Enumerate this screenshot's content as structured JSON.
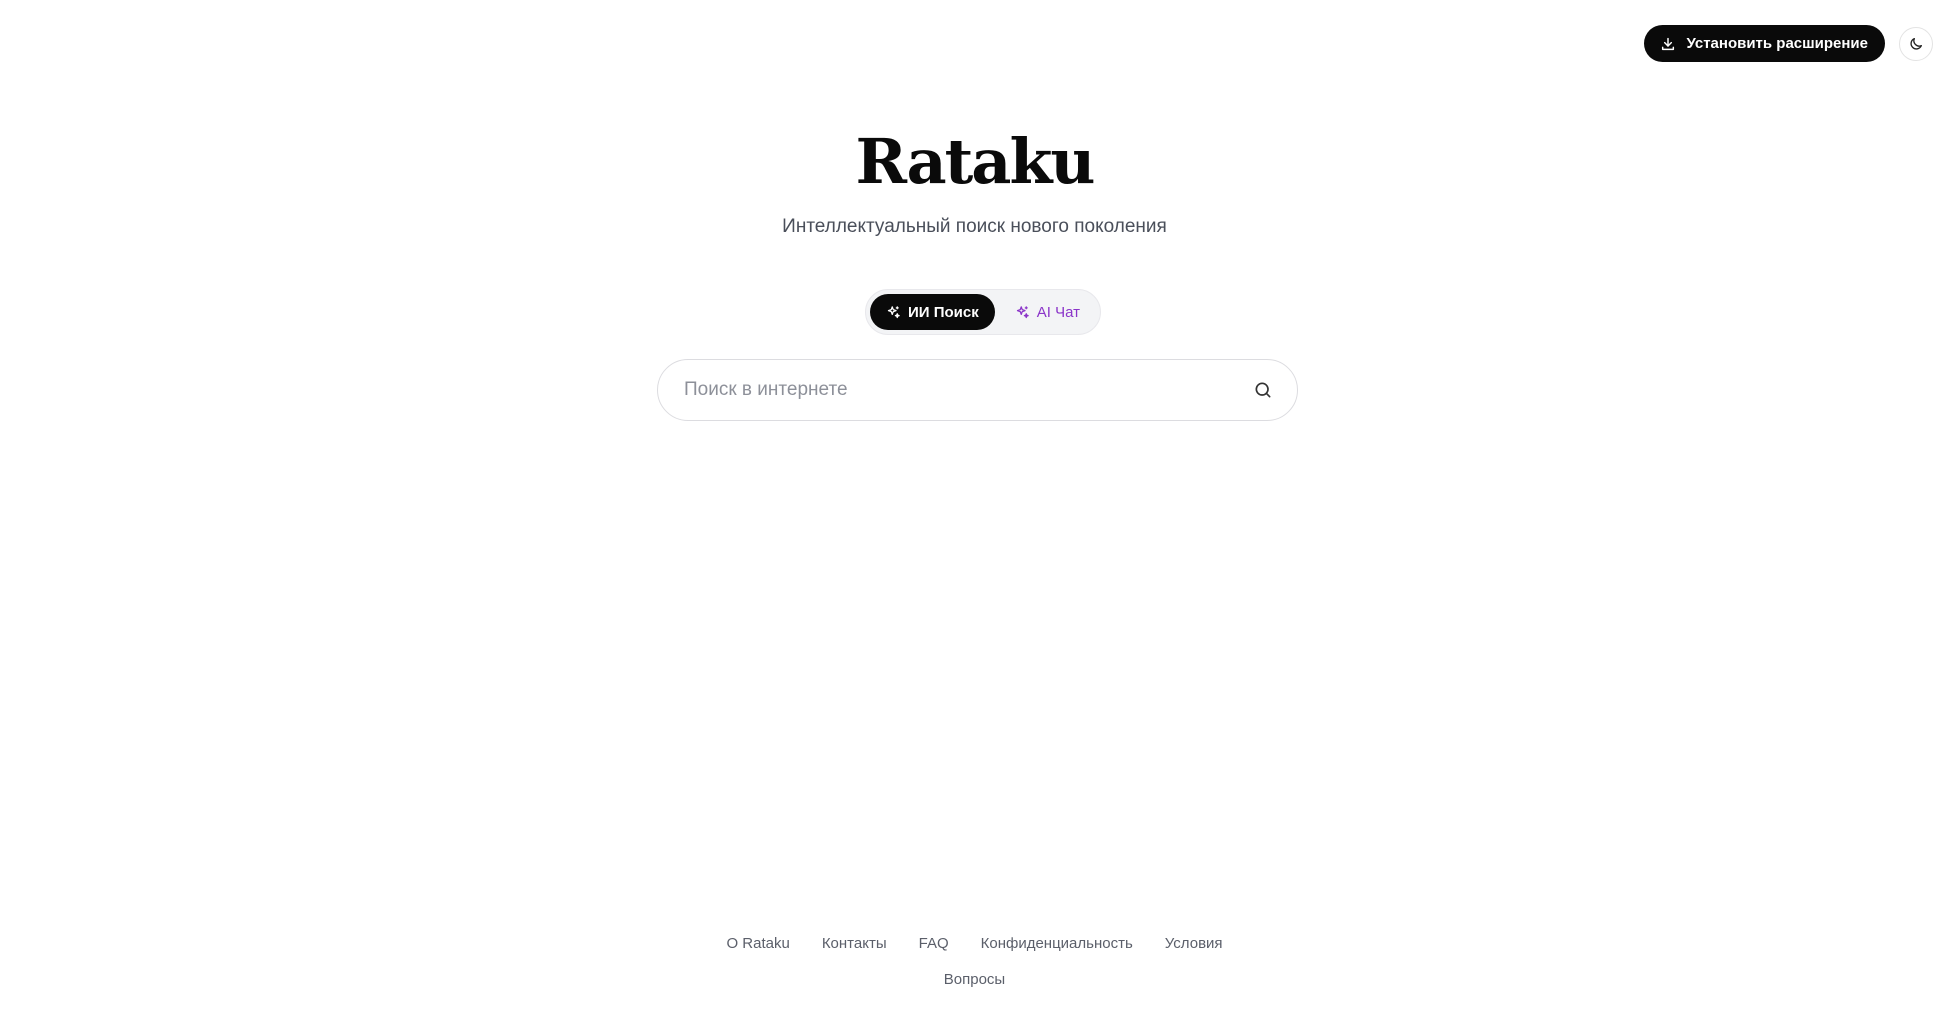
{
  "header": {
    "install_label": "Установить расширение",
    "install_icon": "download-icon",
    "theme_icon": "moon-icon"
  },
  "hero": {
    "logo": "Rataku",
    "tagline": "Интеллектуальный поиск нового поколения"
  },
  "modes": [
    {
      "label": "ИИ Поиск",
      "icon": "sparkles-icon",
      "active": true
    },
    {
      "label": "AI Чат",
      "icon": "sparkles-icon",
      "active": false
    }
  ],
  "search": {
    "placeholder": "Поиск в интернете",
    "value": "",
    "icon": "search-icon"
  },
  "footer": {
    "row1": [
      "О Rataku",
      "Контакты",
      "FAQ",
      "Конфиденциальность",
      "Условия"
    ],
    "row2": [
      "Вопросы"
    ]
  },
  "colors": {
    "primary": "#0a0a0a",
    "accent_purple": "#8b35c9",
    "muted_text": "#5b5f6a",
    "border": "#dcdce0"
  }
}
